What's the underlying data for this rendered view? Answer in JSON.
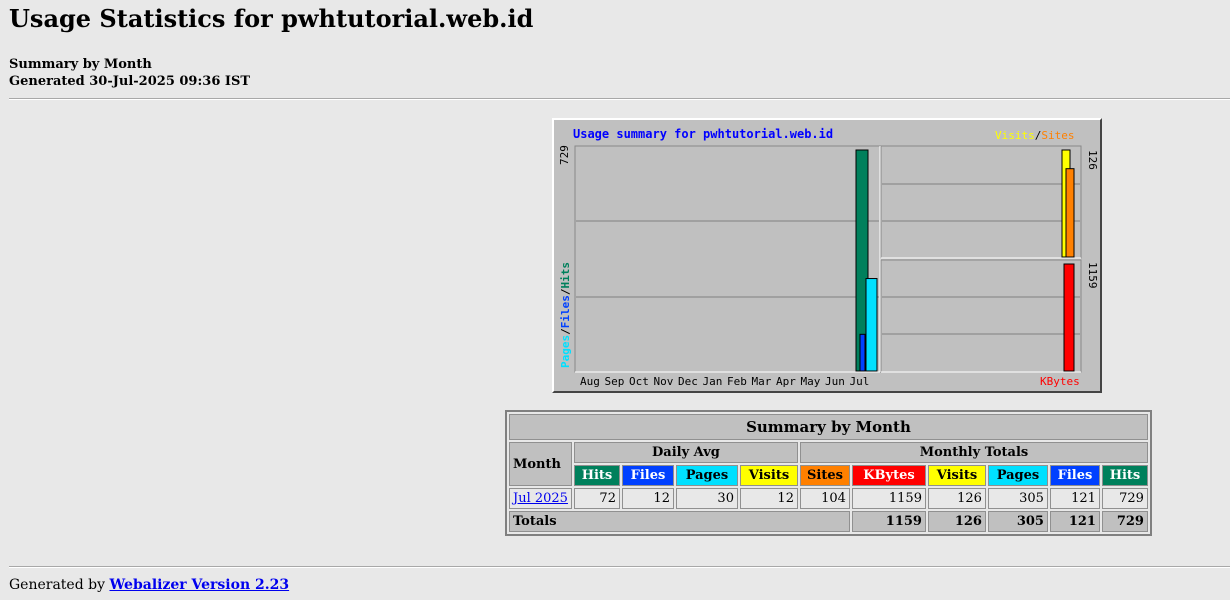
{
  "page": {
    "title": "Usage Statistics for pwhtutorial.web.id",
    "summary_label": "Summary by Month",
    "generated_label": "Generated 30-Jul-2025 09:36 IST"
  },
  "colors": {
    "hits": "#00805c",
    "files": "#0040ff",
    "pages": "#00e0ff",
    "visits": "#ffff00",
    "sites": "#ff8000",
    "kbytes": "#ff0000",
    "panel": "#c0c0c0",
    "title_blue": "#0000ff"
  },
  "graph": {
    "title": "Usage summary for pwhtutorial.web.id",
    "left_legend": {
      "pages": "Pages",
      "files": "Files",
      "hits": "Hits",
      "sep": "/"
    },
    "right_legend": {
      "visits": "Visits",
      "sites": "Sites",
      "sep": "/"
    },
    "kbytes_label": "KBytes",
    "left_axis_max": "729",
    "upper_right_axis_max": "126",
    "lower_right_axis_max": "1159"
  },
  "chart_data": {
    "type": "bar",
    "categories": [
      "Aug",
      "Sep",
      "Oct",
      "Nov",
      "Dec",
      "Jan",
      "Feb",
      "Mar",
      "Apr",
      "May",
      "Jun",
      "Jul"
    ],
    "series": [
      {
        "name": "Hits",
        "values": [
          0,
          0,
          0,
          0,
          0,
          0,
          0,
          0,
          0,
          0,
          0,
          729
        ]
      },
      {
        "name": "Files",
        "values": [
          0,
          0,
          0,
          0,
          0,
          0,
          0,
          0,
          0,
          0,
          0,
          121
        ]
      },
      {
        "name": "Pages",
        "values": [
          0,
          0,
          0,
          0,
          0,
          0,
          0,
          0,
          0,
          0,
          0,
          305
        ]
      },
      {
        "name": "Visits",
        "values": [
          0,
          0,
          0,
          0,
          0,
          0,
          0,
          0,
          0,
          0,
          0,
          126
        ]
      },
      {
        "name": "Sites",
        "values": [
          0,
          0,
          0,
          0,
          0,
          0,
          0,
          0,
          0,
          0,
          0,
          104
        ]
      },
      {
        "name": "KBytes",
        "values": [
          0,
          0,
          0,
          0,
          0,
          0,
          0,
          0,
          0,
          0,
          0,
          1159
        ]
      }
    ],
    "title": "Usage summary for pwhtutorial.web.id",
    "ylim_left": [
      0,
      729
    ],
    "ylim_visits": [
      0,
      126
    ],
    "ylim_kbytes": [
      0,
      1159
    ],
    "grid": true
  },
  "table": {
    "caption": "Summary by Month",
    "month_header": "Month",
    "daily_avg_header": "Daily Avg",
    "monthly_totals_header": "Monthly Totals",
    "daily_cols": [
      "Hits",
      "Files",
      "Pages",
      "Visits"
    ],
    "monthly_cols": [
      "Sites",
      "KBytes",
      "Visits",
      "Pages",
      "Files",
      "Hits"
    ],
    "rows": [
      {
        "month": "Jul 2025",
        "daily": [
          "72",
          "12",
          "30",
          "12"
        ],
        "monthly": [
          "104",
          "1159",
          "126",
          "305",
          "121",
          "729"
        ]
      }
    ],
    "totals_label": "Totals",
    "totals": [
      "1159",
      "126",
      "305",
      "121",
      "729"
    ]
  },
  "footer": {
    "prefix": "Generated by",
    "link": "Webalizer Version 2.23"
  }
}
